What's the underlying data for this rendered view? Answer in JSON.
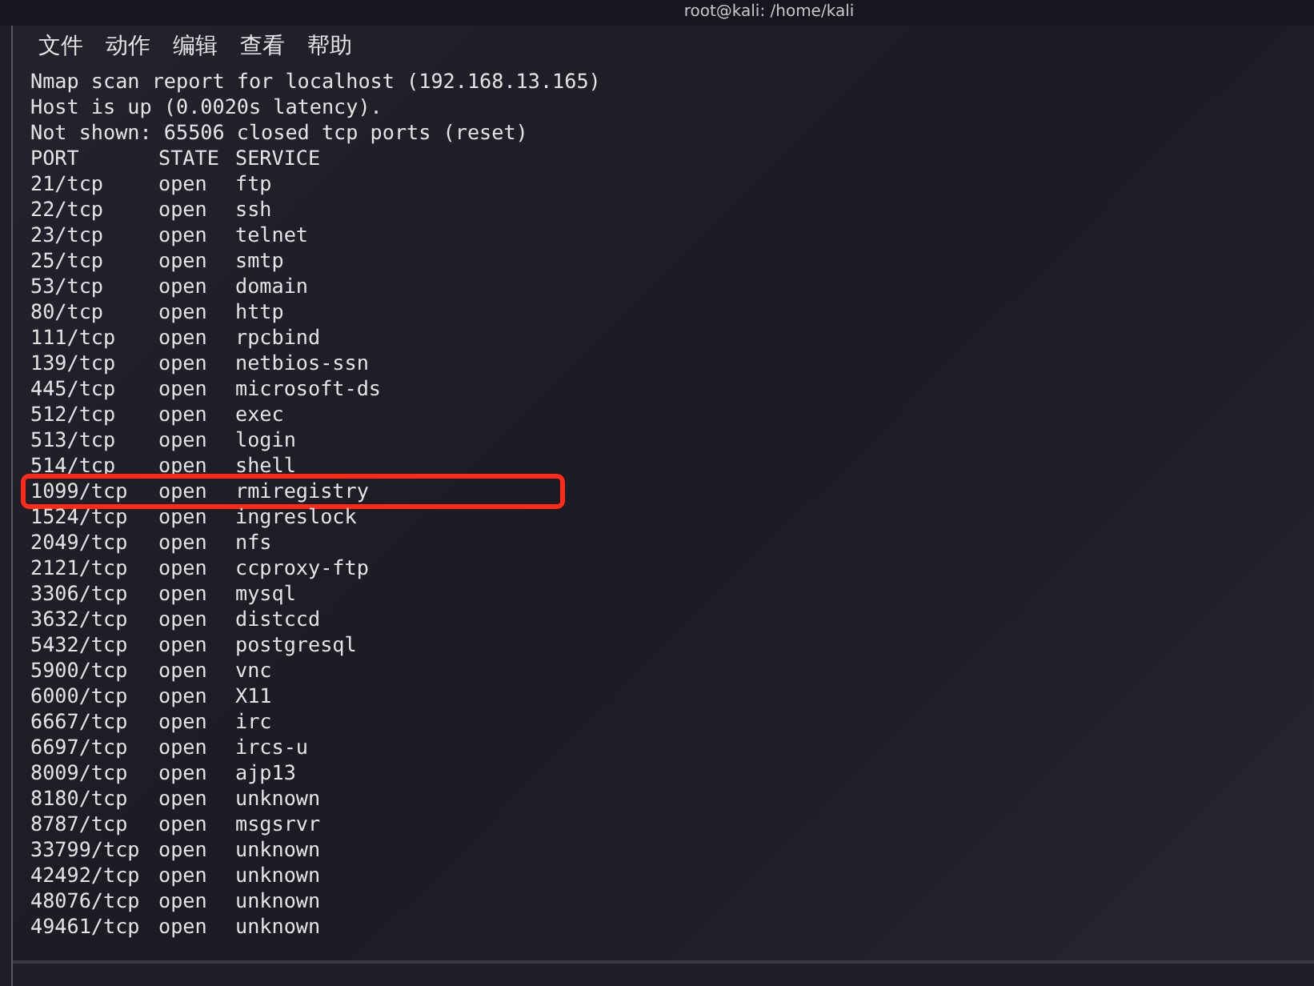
{
  "window": {
    "title": "root@kali: /home/kali"
  },
  "menu": [
    "文件",
    "动作",
    "编辑",
    "查看",
    "帮助"
  ],
  "output_lines": [
    "Nmap scan report for localhost (192.168.13.165)",
    "Host is up (0.0020s latency).",
    "Not shown: 65506 closed tcp ports (reset)"
  ],
  "table": {
    "columns": [
      "PORT",
      "STATE",
      "SERVICE"
    ],
    "rows": [
      {
        "port": "21/tcp",
        "state": "open",
        "service": "ftp",
        "highlighted": false
      },
      {
        "port": "22/tcp",
        "state": "open",
        "service": "ssh",
        "highlighted": false
      },
      {
        "port": "23/tcp",
        "state": "open",
        "service": "telnet",
        "highlighted": false
      },
      {
        "port": "25/tcp",
        "state": "open",
        "service": "smtp",
        "highlighted": false
      },
      {
        "port": "53/tcp",
        "state": "open",
        "service": "domain",
        "highlighted": false
      },
      {
        "port": "80/tcp",
        "state": "open",
        "service": "http",
        "highlighted": false
      },
      {
        "port": "111/tcp",
        "state": "open",
        "service": "rpcbind",
        "highlighted": false
      },
      {
        "port": "139/tcp",
        "state": "open",
        "service": "netbios-ssn",
        "highlighted": false
      },
      {
        "port": "445/tcp",
        "state": "open",
        "service": "microsoft-ds",
        "highlighted": false
      },
      {
        "port": "512/tcp",
        "state": "open",
        "service": "exec",
        "highlighted": false
      },
      {
        "port": "513/tcp",
        "state": "open",
        "service": "login",
        "highlighted": false
      },
      {
        "port": "514/tcp",
        "state": "open",
        "service": "shell",
        "highlighted": false
      },
      {
        "port": "1099/tcp",
        "state": "open",
        "service": "rmiregistry",
        "highlighted": true
      },
      {
        "port": "1524/tcp",
        "state": "open",
        "service": "ingreslock",
        "highlighted": false
      },
      {
        "port": "2049/tcp",
        "state": "open",
        "service": "nfs",
        "highlighted": false
      },
      {
        "port": "2121/tcp",
        "state": "open",
        "service": "ccproxy-ftp",
        "highlighted": false
      },
      {
        "port": "3306/tcp",
        "state": "open",
        "service": "mysql",
        "highlighted": false
      },
      {
        "port": "3632/tcp",
        "state": "open",
        "service": "distccd",
        "highlighted": false
      },
      {
        "port": "5432/tcp",
        "state": "open",
        "service": "postgresql",
        "highlighted": false
      },
      {
        "port": "5900/tcp",
        "state": "open",
        "service": "vnc",
        "highlighted": false
      },
      {
        "port": "6000/tcp",
        "state": "open",
        "service": "X11",
        "highlighted": false
      },
      {
        "port": "6667/tcp",
        "state": "open",
        "service": "irc",
        "highlighted": false
      },
      {
        "port": "6697/tcp",
        "state": "open",
        "service": "ircs-u",
        "highlighted": false
      },
      {
        "port": "8009/tcp",
        "state": "open",
        "service": "ajp13",
        "highlighted": false
      },
      {
        "port": "8180/tcp",
        "state": "open",
        "service": "unknown",
        "highlighted": false
      },
      {
        "port": "8787/tcp",
        "state": "open",
        "service": "msgsrvr",
        "highlighted": false
      },
      {
        "port": "33799/tcp",
        "state": "open",
        "service": "unknown",
        "highlighted": false
      },
      {
        "port": "42492/tcp",
        "state": "open",
        "service": "unknown",
        "highlighted": false
      },
      {
        "port": "48076/tcp",
        "state": "open",
        "service": "unknown",
        "highlighted": false
      },
      {
        "port": "49461/tcp",
        "state": "open",
        "service": "unknown",
        "highlighted": false
      }
    ]
  }
}
